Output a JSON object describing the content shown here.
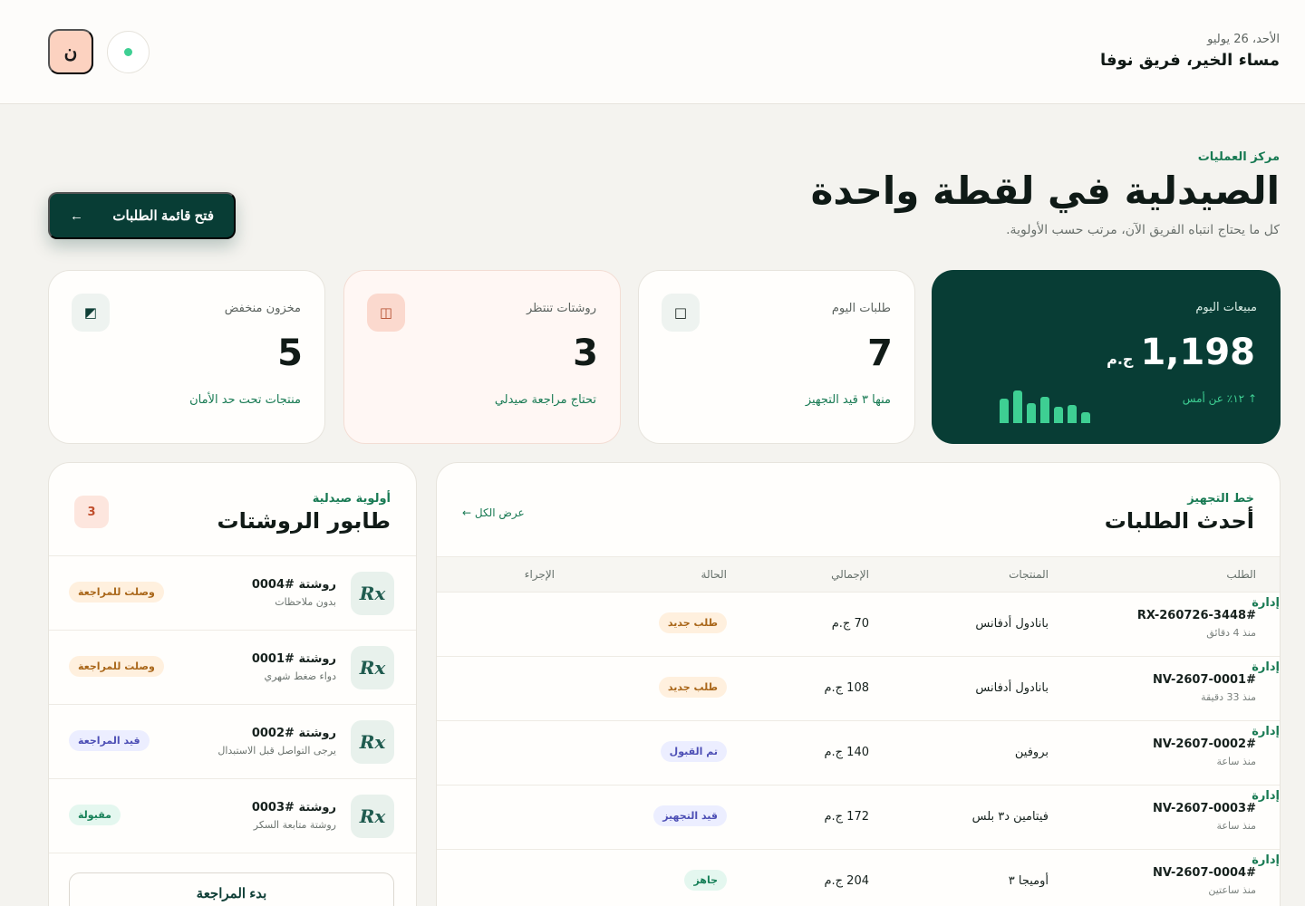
{
  "header": {
    "date": "الأحد، 26 يوليو",
    "greeting": "مساء الخير، فريق نوفا",
    "avatar_initial": "ن",
    "status_color": "#3ecf93"
  },
  "hero": {
    "eyebrow": "مركز العمليات",
    "title": "الصيدلية في لقطة واحدة",
    "subtitle": "كل ما يحتاج انتباه الفريق الآن، مرتب حسب الأولوية.",
    "button_label": "فتح قائمة الطلبات",
    "button_arrow": "←"
  },
  "stats": {
    "sales": {
      "label": "مبيعات اليوم",
      "currency": "ج.م",
      "value": "1,198",
      "note": "↑ ١٢٪ عن أمس",
      "bars": [
        0.68,
        0.9,
        0.55,
        0.72,
        0.45,
        0.5,
        0.3
      ]
    },
    "orders": {
      "label": "طلبات اليوم",
      "value": "7",
      "note": "منها ٣ قيد التجهيز",
      "icon": "box-icon",
      "glyph": "□"
    },
    "rx": {
      "label": "روشتات تنتظر",
      "value": "3",
      "note": "تحتاج مراجعة صيدلي",
      "icon": "document-icon",
      "glyph": "◫"
    },
    "stock": {
      "label": "مخزون منخفض",
      "value": "5",
      "note": "منتجات تحت حد الأمان",
      "icon": "warning-icon",
      "glyph": "◩"
    }
  },
  "orders": {
    "kicker": "خط التجهيز",
    "title": "أحدث الطلبات",
    "view_all": "عرض الكل ←",
    "columns": {
      "id": "الطلب",
      "products": "المنتجات",
      "total": "الإجمالي",
      "status": "الحالة",
      "action": "الإجراء"
    },
    "rows": [
      {
        "id": "RX-260726-3448#",
        "time": "منذ 4 دقائق",
        "products": "بانادول أدفانس",
        "total": "70 ج.م",
        "status": "طلب جديد",
        "action": "إدارة"
      },
      {
        "id": "NV-2607-0001#",
        "time": "منذ 33 دقيقة",
        "products": "بانادول أدفانس",
        "total": "108 ج.م",
        "status": "طلب جديد",
        "action": "إدارة"
      },
      {
        "id": "NV-2607-0002#",
        "time": "منذ ساعة",
        "products": "بروفين",
        "total": "140 ج.م",
        "status": "تم القبول",
        "action": "إدارة"
      },
      {
        "id": "NV-2607-0003#",
        "time": "منذ ساعة",
        "products": "فيتامين د٣ بلس",
        "total": "172 ج.م",
        "status": "قيد التجهيز",
        "action": "إدارة"
      },
      {
        "id": "NV-2607-0004#",
        "time": "منذ ساعتين",
        "products": "أوميجا ٣",
        "total": "204 ج.م",
        "status": "جاهز",
        "action": "إدارة"
      }
    ]
  },
  "queue": {
    "kicker": "أولوية صيدلية",
    "title": "طابور الروشتات",
    "count": "3",
    "items": [
      {
        "name": "روشتة #0004",
        "note": "بدون ملاحظات",
        "status": "وصلت للمراجعة"
      },
      {
        "name": "روشتة #0001",
        "note": "دواء ضغط شهري",
        "status": "وصلت للمراجعة"
      },
      {
        "name": "روشتة #0002",
        "note": "يرجى التواصل قبل الاستبدال",
        "status": "قيد المراجعة"
      },
      {
        "name": "روشتة #0003",
        "note": "روشتة متابعة السكر",
        "status": "مقبولة"
      }
    ],
    "start_button": "بدء المراجعة",
    "rx_icon": "Rx"
  }
}
